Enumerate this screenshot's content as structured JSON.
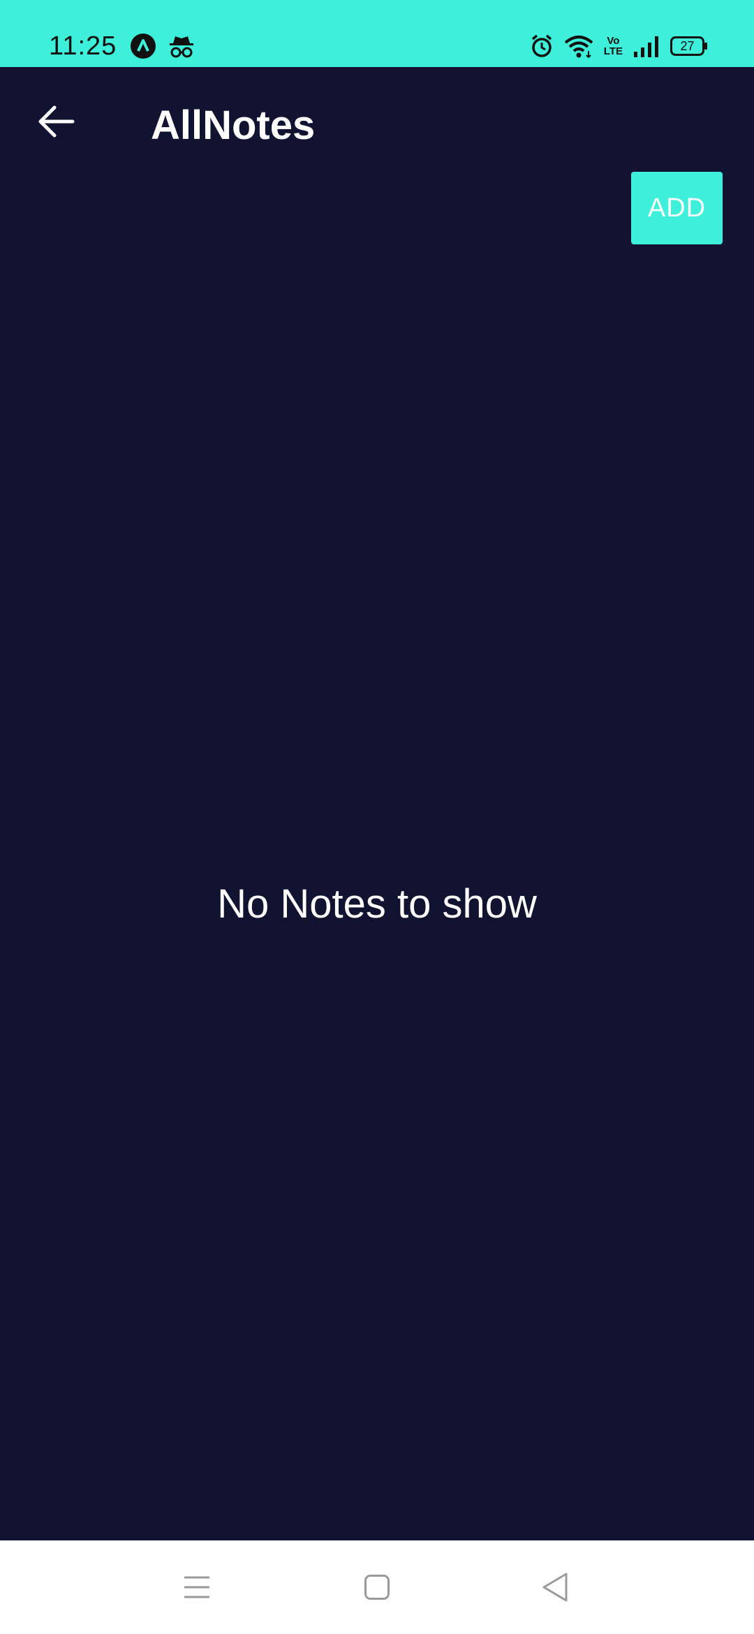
{
  "status_bar": {
    "time": "11:25",
    "battery_level": "27",
    "network_label_top": "Vo",
    "network_label_bottom": "LTE",
    "icons": [
      "app-logo-icon",
      "incognito-icon",
      "alarm-icon",
      "wifi-icon",
      "volte-icon",
      "signal-icon",
      "battery-icon"
    ]
  },
  "app_bar": {
    "title": "AllNotes",
    "back_icon": "arrow-left-icon"
  },
  "actions": {
    "add_label": "ADD"
  },
  "empty_state": {
    "message": "No Notes to show"
  },
  "nav_bar": {
    "icons": [
      "menu-icon",
      "home-icon",
      "back-triangle-icon"
    ]
  },
  "colors": {
    "accent": "#3eefd9",
    "background": "#121330",
    "text": "#ffffff",
    "nav_background": "#ffffff",
    "nav_icon": "#9a9a9a"
  }
}
